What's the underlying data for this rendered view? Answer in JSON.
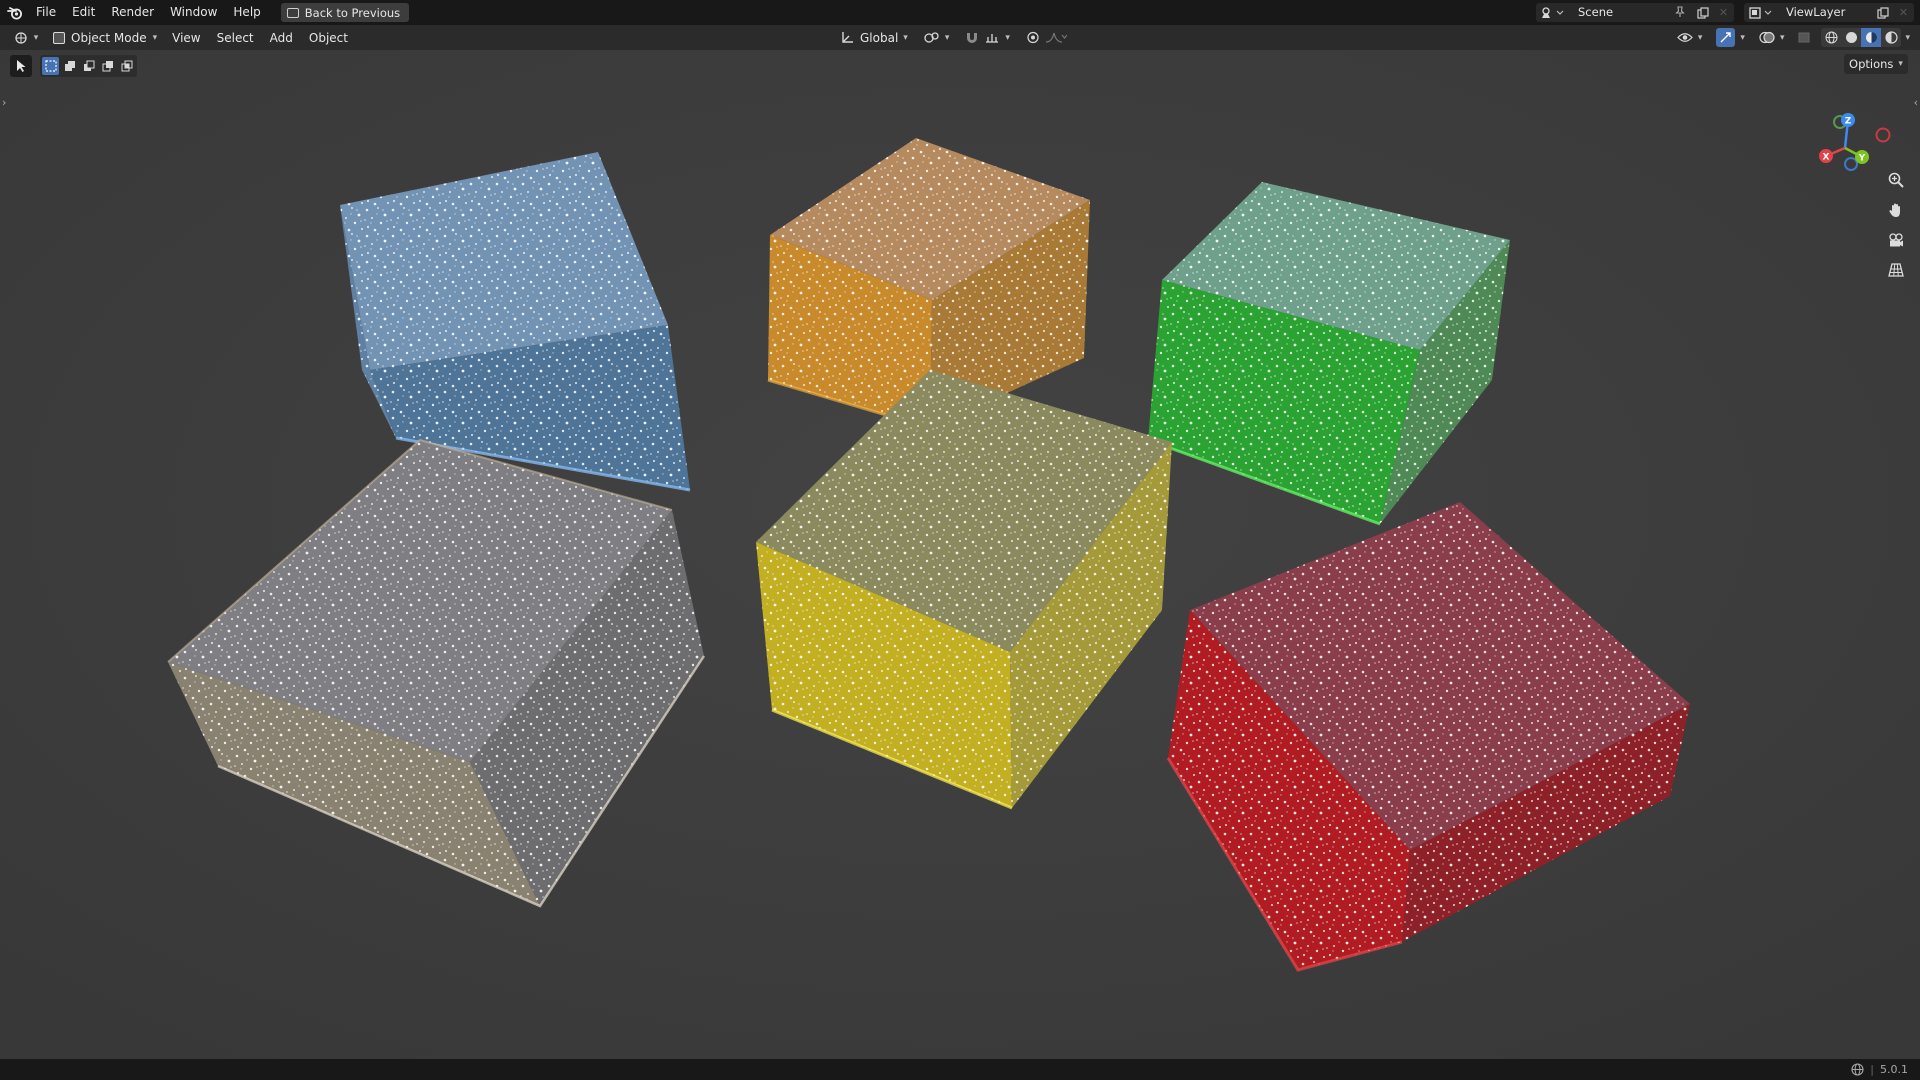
{
  "menu": {
    "file": "File",
    "edit": "Edit",
    "render": "Render",
    "window": "Window",
    "help": "Help",
    "back_to_previous": "Back to Previous"
  },
  "topbar_right": {
    "scene_name": "Scene",
    "view_layer_name": "ViewLayer"
  },
  "header": {
    "mode": "Object Mode",
    "view": "View",
    "select": "Select",
    "add": "Add",
    "object": "Object",
    "transform_orientation": "Global"
  },
  "viewport": {
    "options_label": "Options",
    "gizmo": {
      "x": "X",
      "y": "Y",
      "z": "Z"
    },
    "axis_colors": {
      "x": "#e2424a",
      "y": "#7ec420",
      "z": "#3d8bf1"
    },
    "cube_colors": {
      "blue": "#6f93b8",
      "orange": "#c98a30",
      "green": "#2fb13a",
      "clear": "#8d8a86",
      "yellow": "#c7b628",
      "red": "#b6222a"
    }
  },
  "status": {
    "version": "5.0.1"
  },
  "accent_color": "#4772b3"
}
